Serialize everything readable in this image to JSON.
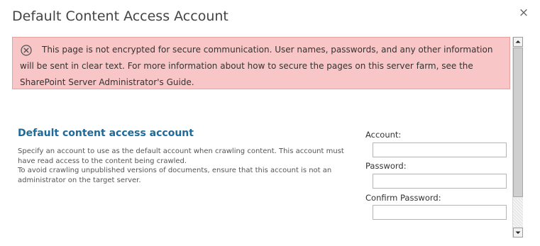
{
  "dialog": {
    "title": "Default Content Access Account",
    "close_label": "×"
  },
  "warning": {
    "icon": "error-circle-x-icon",
    "text": "This page is not encrypted for secure communication. User names, passwords, and any other information will be sent in clear text. For more information about how to secure the pages on this server farm, see the SharePoint Server Administrator's Guide."
  },
  "section": {
    "heading": "Default content access account",
    "description_1": "Specify an account to use as the default account when crawling content.  This account must have read access to the content being crawled.",
    "description_2": "To avoid crawling unpublished versions of documents, ensure that this account is not an administrator on the target server."
  },
  "form": {
    "account_label": "Account:",
    "account_value": "",
    "password_label": "Password:",
    "password_value": "",
    "confirm_password_label": "Confirm Password:",
    "confirm_password_value": ""
  },
  "colors": {
    "warning_bg": "#f8c6c6",
    "heading": "#1e6a9b"
  }
}
